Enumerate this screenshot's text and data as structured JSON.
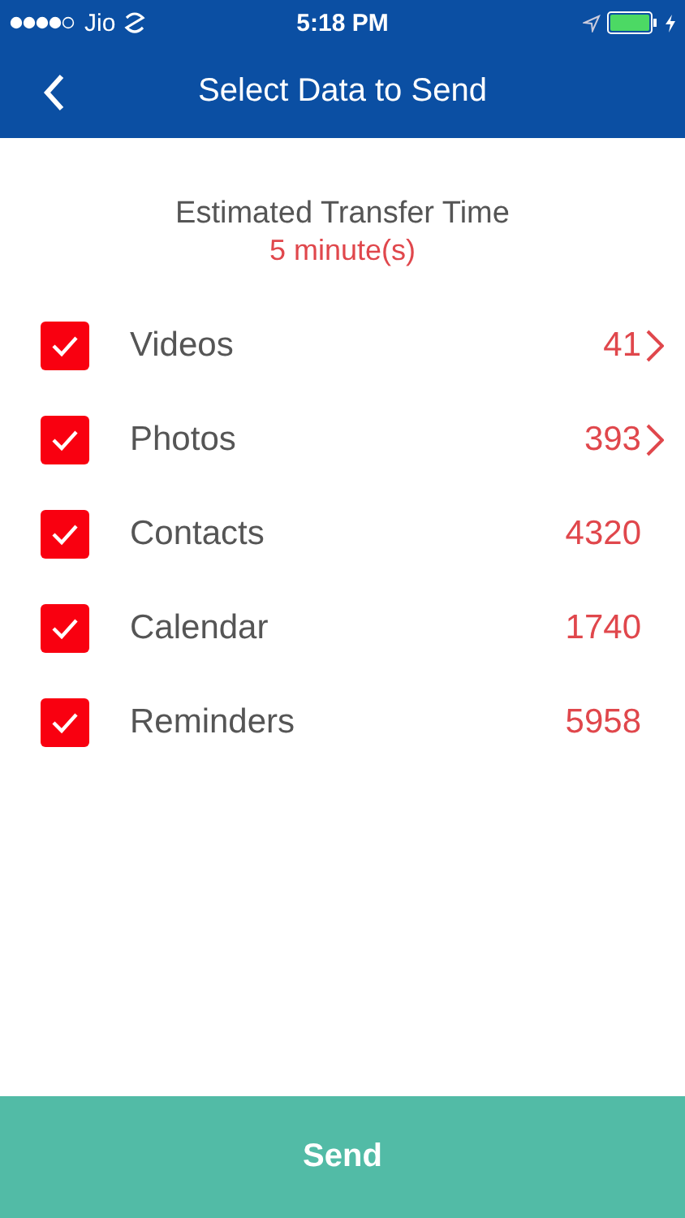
{
  "status_bar": {
    "carrier": "Jio",
    "time": "5:18 PM"
  },
  "nav": {
    "title": "Select Data to Send"
  },
  "estimate": {
    "label": "Estimated Transfer Time",
    "value": "5 minute(s)"
  },
  "items": [
    {
      "label": "Videos",
      "count": "41",
      "checked": true,
      "expandable": true
    },
    {
      "label": "Photos",
      "count": "393",
      "checked": true,
      "expandable": true
    },
    {
      "label": "Contacts",
      "count": "4320",
      "checked": true,
      "expandable": false
    },
    {
      "label": "Calendar",
      "count": "1740",
      "checked": true,
      "expandable": false
    },
    {
      "label": "Reminders",
      "count": "5958",
      "checked": true,
      "expandable": false
    }
  ],
  "send_button": "Send"
}
